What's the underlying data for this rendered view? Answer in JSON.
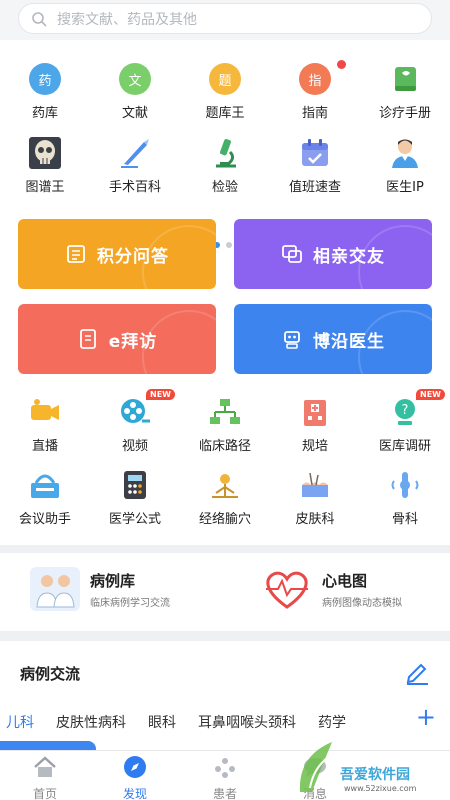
{
  "search": {
    "placeholder": "搜索文献、药品及其他"
  },
  "grid_top": [
    {
      "label": "药库",
      "glyph": "药",
      "color": "#4da6e8",
      "icon": "drug-icon"
    },
    {
      "label": "文献",
      "glyph": "文",
      "color": "#7bcf6a",
      "icon": "literature-icon"
    },
    {
      "label": "题库王",
      "glyph": "题",
      "color": "#f6b83c",
      "icon": "question-bank-icon"
    },
    {
      "label": "指南",
      "glyph": "指",
      "color": "#f27a55",
      "icon": "guide-icon"
    },
    {
      "label": "诊疗手册",
      "glyph": "",
      "color": "#5cb85c",
      "icon": "manual-book-icon"
    }
  ],
  "grid_second": [
    {
      "label": "图谱王",
      "icon": "skull-atlas-icon"
    },
    {
      "label": "手术百科",
      "icon": "scalpel-icon"
    },
    {
      "label": "检验",
      "icon": "microscope-icon"
    },
    {
      "label": "值班速查",
      "icon": "calendar-icon"
    },
    {
      "label": "医生IP",
      "icon": "doctor-icon"
    }
  ],
  "cards": [
    {
      "label": "积分问答",
      "color": "#f5a524",
      "icon": "qa-icon"
    },
    {
      "label": "相亲交友",
      "color": "#8b63f0",
      "icon": "chat-icon"
    },
    {
      "label": "e拜访",
      "color": "#f36c5c",
      "icon": "visit-icon"
    },
    {
      "label": "博沿医生",
      "color": "#3e84ef",
      "icon": "robot-icon"
    }
  ],
  "grid_third": [
    {
      "label": "直播",
      "icon": "video-camera-icon"
    },
    {
      "label": "视频",
      "icon": "film-reel-icon",
      "badge": "NEW"
    },
    {
      "label": "临床路径",
      "icon": "flowchart-icon"
    },
    {
      "label": "规培",
      "icon": "hospital-icon"
    },
    {
      "label": "医库调研",
      "icon": "survey-icon",
      "badge": "NEW"
    }
  ],
  "grid_fourth": [
    {
      "label": "会议助手",
      "icon": "meeting-icon"
    },
    {
      "label": "医学公式",
      "icon": "calculator-icon"
    },
    {
      "label": "经络腧穴",
      "icon": "acupoint-icon"
    },
    {
      "label": "皮肤科",
      "icon": "skin-icon"
    },
    {
      "label": "骨科",
      "icon": "bone-icon"
    }
  ],
  "cases": [
    {
      "title": "病例库",
      "subtitle": "临床病例学习交流",
      "icon": "doctors-icon"
    },
    {
      "title": "心电图",
      "subtitle": "病例图像动态模拟",
      "icon": "heart-ecg-icon"
    }
  ],
  "exchange": {
    "title": "病例交流",
    "tabs": [
      "儿科",
      "皮肤性病科",
      "眼科",
      "耳鼻咽喉头颈科",
      "药学"
    ],
    "plus": "+"
  },
  "nav": [
    {
      "label": "首页",
      "icon": "home-icon"
    },
    {
      "label": "发现",
      "icon": "compass-icon",
      "active": true
    },
    {
      "label": "患者",
      "icon": "patient-icon"
    },
    {
      "label": "消息",
      "icon": "message-icon"
    }
  ],
  "watermark": {
    "text": "吾爱软件园",
    "url": "www.52zixue.com"
  },
  "colors": {
    "accent": "#2f7cf0",
    "badge": "#f04a3a"
  }
}
